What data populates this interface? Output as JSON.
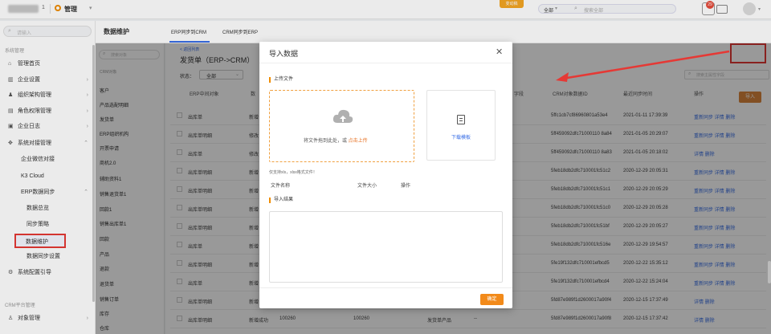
{
  "topbar": {
    "logo_text": "1",
    "app_title": "管理",
    "badge_text": "变动稿",
    "scope": "全部",
    "search_placeholder": "搜索全部",
    "notif_count": "29"
  },
  "sidebar": {
    "search_placeholder": "请输入",
    "section_system": "系统管理",
    "items": [
      {
        "label": "管理首页"
      },
      {
        "label": "企业设置"
      },
      {
        "label": "组织架构管理"
      },
      {
        "label": "角色权限管理"
      },
      {
        "label": "企业日志"
      },
      {
        "label": "系统对接管理"
      },
      {
        "label": "企业微信对接"
      },
      {
        "label": "K3 Cloud"
      },
      {
        "label": "ERP数据同步"
      },
      {
        "label": "数据总览"
      },
      {
        "label": "同步策略"
      },
      {
        "label": "数据维护"
      },
      {
        "label": "数据同步设置"
      },
      {
        "label": "系统配置引导"
      }
    ],
    "section_crm": "CRM平台管理",
    "bottom_item": "对象管理"
  },
  "main_header": {
    "title": "数据维护",
    "tabs": [
      {
        "label": "ERP同步到CRM"
      },
      {
        "label": "CRM同步到ERP"
      }
    ]
  },
  "sublist": {
    "search_placeholder": "搜索对象",
    "group": "CRM对象",
    "items": [
      "客户",
      "产品选配明细",
      "发货单",
      "ERP组织机构",
      "开票申请",
      "商机2.0",
      "辅助资料1",
      "销售退货单1",
      "回款1",
      "销售出库单1",
      "回款",
      "产品",
      "退款",
      "退货单",
      "销售订单",
      "库存",
      "仓库"
    ]
  },
  "content": {
    "back_label": "< 返回列表",
    "page_title": "发货单（ERP->CRM）",
    "state_label": "状态：",
    "state_value": "全部",
    "import_label": "导入",
    "right_search_placeholder": "搜索主属性字段",
    "columns": {
      "col1": "ERP中间对象",
      "col2": "数",
      "col3": "字段",
      "col4": "CRM对象数据ID",
      "col5": "最近同步时间",
      "col6": "操作"
    },
    "rows": [
      {
        "obj": "出库单",
        "st": "新增",
        "id": "5ffc1cb7cf86960801a53e4",
        "time": "2021-01-11 17:39:39",
        "ops": "重新同步  详情  删除"
      },
      {
        "obj": "出库单明细",
        "st": "修改",
        "id": "5ff459092dfc71000110 8a84",
        "time": "2021-01-05 20:29:07",
        "ops": "重新同步  详情  删除"
      },
      {
        "obj": "出库单",
        "st": "修改",
        "id": "5ff459092dfc71000110 8a83",
        "time": "2021-01-05 20:18:02",
        "ops": "详情  删除"
      },
      {
        "obj": "出库单明细",
        "st": "新增",
        "id": "5feb18db2dfc710001fc51c2",
        "time": "2020-12-29 20:05:31",
        "ops": "重新同步  详情  删除"
      },
      {
        "obj": "出库单明细",
        "st": "新增",
        "id": "5feb18db2dfc710001fc51c1",
        "time": "2020-12-29 20:05:29",
        "ops": "重新同步  详情  删除"
      },
      {
        "obj": "出库单明细",
        "st": "新增",
        "id": "5feb18db2dfc710001fc51c0",
        "time": "2020-12-29 20:05:28",
        "ops": "重新同步  详情  删除"
      },
      {
        "obj": "出库单明细",
        "st": "新增",
        "id": "5feb18db2dfc710001fc51bf",
        "time": "2020-12-29 20:05:27",
        "ops": "重新同步  详情  删除"
      },
      {
        "obj": "出库单",
        "st": "新增",
        "id": "5feb18db2dfc710001fc516e",
        "time": "2020-12-29 19:54:57",
        "ops": "重新同步  详情  删除"
      },
      {
        "obj": "出库单明细",
        "st": "新增",
        "id": "5fe19f132dfc710001efbcd5",
        "time": "2020-12-22 15:35:12",
        "ops": "重新同步  详情  删除"
      },
      {
        "obj": "出库单",
        "st": "新增",
        "id": "5fe19f132dfc710001efbcd4",
        "time": "2020-12-22 15:24:04",
        "ops": "重新同步  详情  删除"
      },
      {
        "obj": "出库单明细",
        "st": "新增",
        "id": "5fd87e989f1d2600017a90f4",
        "time": "2020-12-15 17:37:49",
        "ops": "详情  删除"
      },
      {
        "obj": "出库单明细",
        "st": "新增成功",
        "num1": "100260",
        "num2": "100260",
        "prod": "发货单产品",
        "dash": "--",
        "id": "5fd87e989f1d2600017a90f8",
        "time": "2020-12-15 17:37:42",
        "ops": "详情  删除"
      }
    ]
  },
  "modal": {
    "title": "导入数据",
    "section_upload": "上传文件",
    "drop_text": "将文件拖到此处，或 ",
    "drop_link": "点击上传",
    "template_link": "下载模板",
    "hint": "仅支持xls，xlsx格式文件！",
    "col_name": "文件名称",
    "col_size": "文件大小",
    "col_op": "操作",
    "section_result": "导入结果",
    "ok_label": "确定"
  }
}
